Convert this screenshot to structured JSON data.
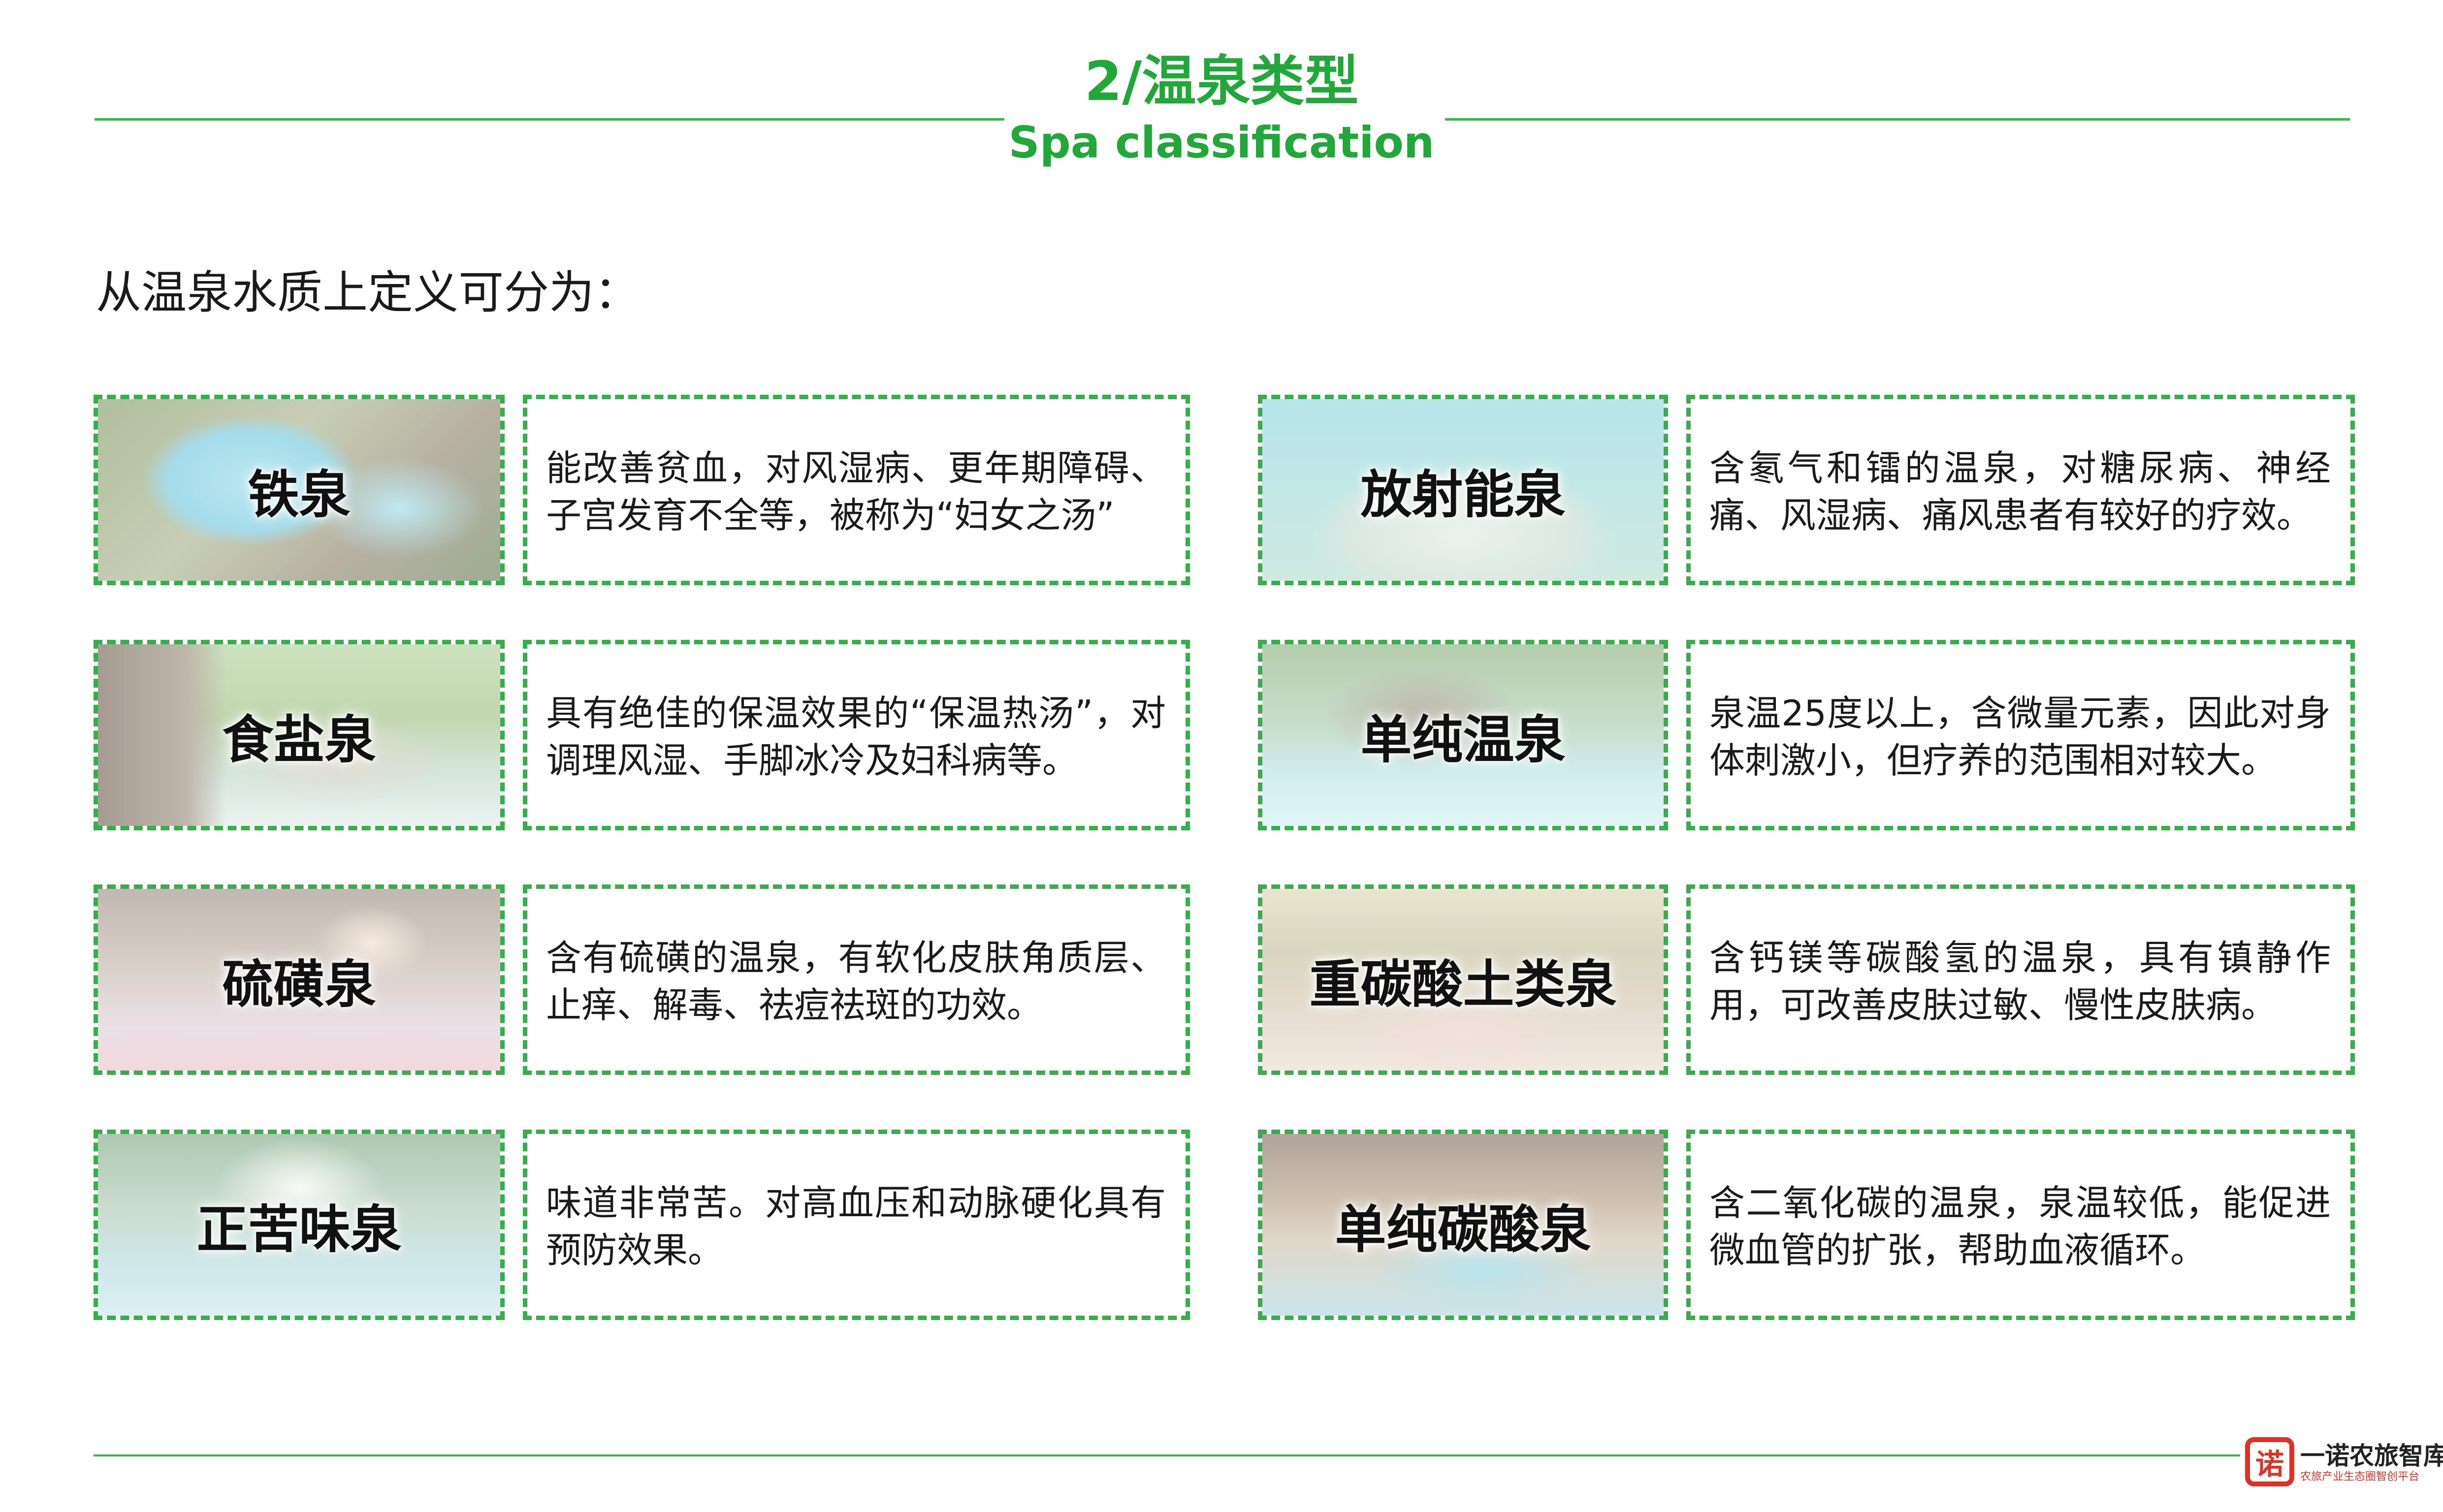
{
  "header": {
    "title_zh": "2/温泉类型",
    "title_en": "Spa classification"
  },
  "intro": "从温泉水质上定义可分为：",
  "items": [
    {
      "name": "铁泉",
      "desc": "能改善贫血，对风湿病、更年期障碍、子宫发育不全等，被称为“妇女之汤”"
    },
    {
      "name": "放射能泉",
      "desc": "含氡气和镭的温泉，对糖尿病、神经痛、风湿病、痛风患者有较好的疗效。"
    },
    {
      "name": "食盐泉",
      "desc": "具有绝佳的保温效果的“保温热汤”，对调理风湿、手脚冰冷及妇科病等。"
    },
    {
      "name": "单纯温泉",
      "desc": "泉温25度以上，含微量元素，因此对身体刺激小，但疗养的范围相对较大。"
    },
    {
      "name": "硫磺泉",
      "desc": " 含有硫磺的温泉，有软化皮肤角质层、止痒、解毒、祛痘祛斑的功效。"
    },
    {
      "name": "重碳酸土类泉",
      "desc": " 含钙镁等碳酸氢的温泉，具有镇静作用，可改善皮肤过敏、慢性皮肤病。"
    },
    {
      "name": "正苦味泉",
      "desc": " 味道非常苦。对高血压和动脉硬化具有预防效果。"
    },
    {
      "name": "单纯碳酸泉",
      "desc": " 含二氧化碳的温泉，泉温较低，能促进微血管的扩张，帮助血液循环。"
    }
  ],
  "footer": {
    "logo_mark": "诺",
    "logo_name": "一诺农旅智库",
    "logo_tagline": "农旅产业生态圈智创平台"
  },
  "colors": {
    "accent_green": "#22a83a",
    "rule_green": "#3cb554",
    "logo_red": "#d9332a"
  }
}
